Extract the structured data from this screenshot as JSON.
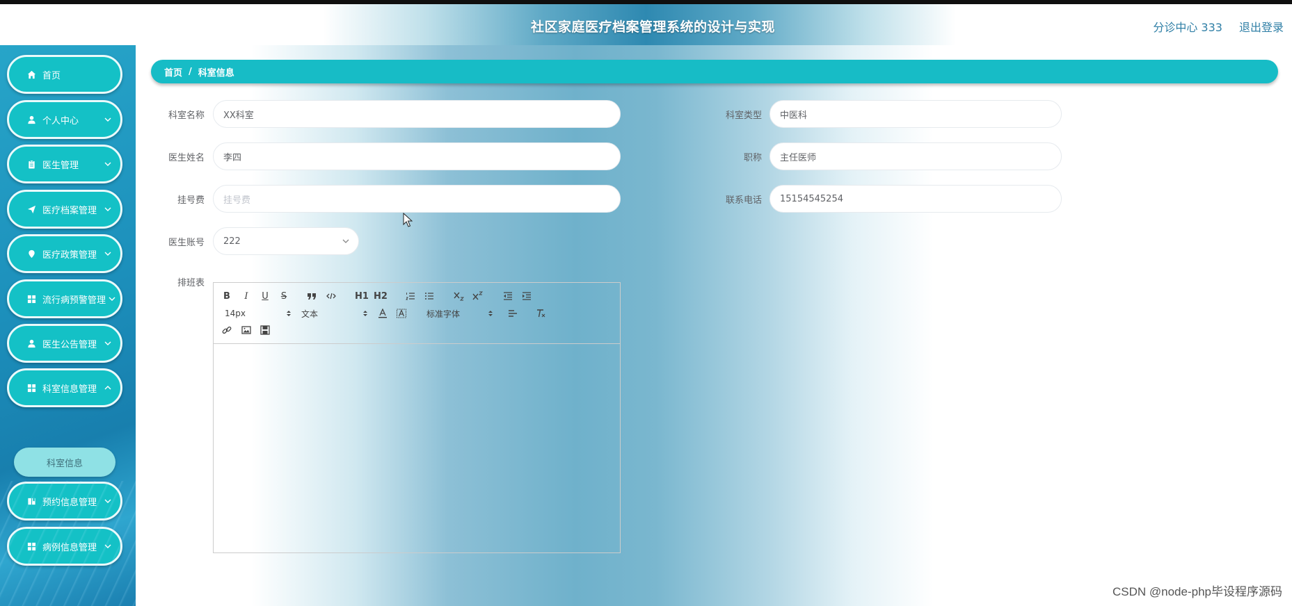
{
  "app": {
    "title": "社区家庭医疗档案管理系统的设计与实现",
    "user_label": "分诊中心 333",
    "logout_label": "退出登录"
  },
  "sidebar": {
    "items": [
      {
        "label": "首页",
        "icon": "home-icon"
      },
      {
        "label": "个人中心",
        "icon": "user-icon"
      },
      {
        "label": "医生管理",
        "icon": "clipboard-icon"
      },
      {
        "label": "医疗档案管理",
        "icon": "paper-plane-icon"
      },
      {
        "label": "医疗政策管理",
        "icon": "location-pin-icon"
      },
      {
        "label": "流行病预警管理",
        "icon": "grid-icon"
      },
      {
        "label": "医生公告管理",
        "icon": "user-icon"
      },
      {
        "label": "科室信息管理",
        "icon": "grid-icon"
      },
      {
        "label": "预约信息管理",
        "icon": "bookmark-icon"
      },
      {
        "label": "病例信息管理",
        "icon": "grid-icon"
      }
    ],
    "sub_item": "科室信息"
  },
  "breadcrumb": {
    "home": "首页",
    "separator": "/",
    "current": "科室信息"
  },
  "form": {
    "dept_name": {
      "label": "科室名称",
      "value": "XX科室"
    },
    "dept_type": {
      "label": "科室类型",
      "value": "中医科"
    },
    "doctor_name": {
      "label": "医生姓名",
      "value": "李四"
    },
    "title": {
      "label": "职称",
      "value": "主任医师"
    },
    "fee": {
      "label": "挂号费",
      "placeholder": "挂号费"
    },
    "phone": {
      "label": "联系电话",
      "value": "15154545254"
    },
    "account": {
      "label": "医生账号",
      "value": "222"
    },
    "schedule": {
      "label": "排班表"
    }
  },
  "editor": {
    "size": "14px",
    "header": "文本",
    "font": "标准字体",
    "buttons": {
      "bold": "B",
      "italic": "I",
      "underline": "U",
      "strike": "S",
      "h1": "H1",
      "h2": "H2"
    }
  },
  "colors": {
    "accent": "#14c1c6",
    "header_link": "#2f7fa6",
    "breadcrumb": "#17bcc6"
  },
  "watermark": "CSDN @node-php毕设程序源码"
}
